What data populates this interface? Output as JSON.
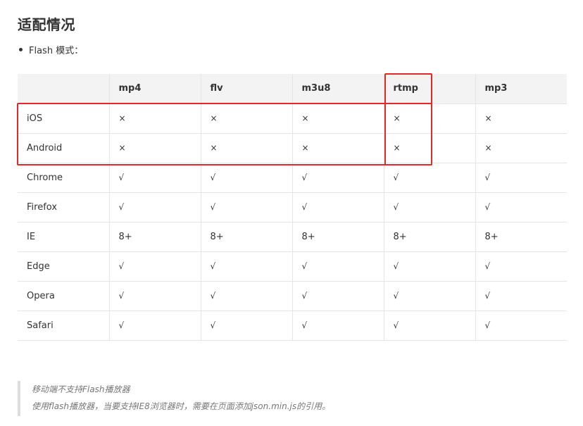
{
  "heading": "适配情况",
  "bullets": [
    "Flash 模式："
  ],
  "table": {
    "headers": [
      "",
      "mp4",
      "flv",
      "m3u8",
      "rtmp",
      "mp3"
    ],
    "rows": [
      {
        "label": "iOS",
        "cells": [
          "×",
          "×",
          "×",
          "×",
          "×"
        ]
      },
      {
        "label": "Android",
        "cells": [
          "×",
          "×",
          "×",
          "×",
          "×"
        ]
      },
      {
        "label": "Chrome",
        "cells": [
          "√",
          "√",
          "√",
          "√",
          "√"
        ]
      },
      {
        "label": "Firefox",
        "cells": [
          "√",
          "√",
          "√",
          "√",
          "√"
        ]
      },
      {
        "label": "IE",
        "cells": [
          "8+",
          "8+",
          "8+",
          "8+",
          "8+"
        ]
      },
      {
        "label": "Edge",
        "cells": [
          "√",
          "√",
          "√",
          "√",
          "√"
        ]
      },
      {
        "label": "Opera",
        "cells": [
          "√",
          "√",
          "√",
          "√",
          "√"
        ]
      },
      {
        "label": "Safari",
        "cells": [
          "√",
          "√",
          "√",
          "√",
          "√"
        ]
      }
    ]
  },
  "note": {
    "lines": [
      "移动端不支持Flash播放器",
      "使用flash播放器，当要支持IE8浏览器时，需要在页面添加json.min.js的引用。"
    ]
  },
  "colors": {
    "highlight": "#e02a2a",
    "header_bg": "#f3f3f3",
    "border": "#e5e5e5",
    "quote_bar": "#dddddd"
  }
}
